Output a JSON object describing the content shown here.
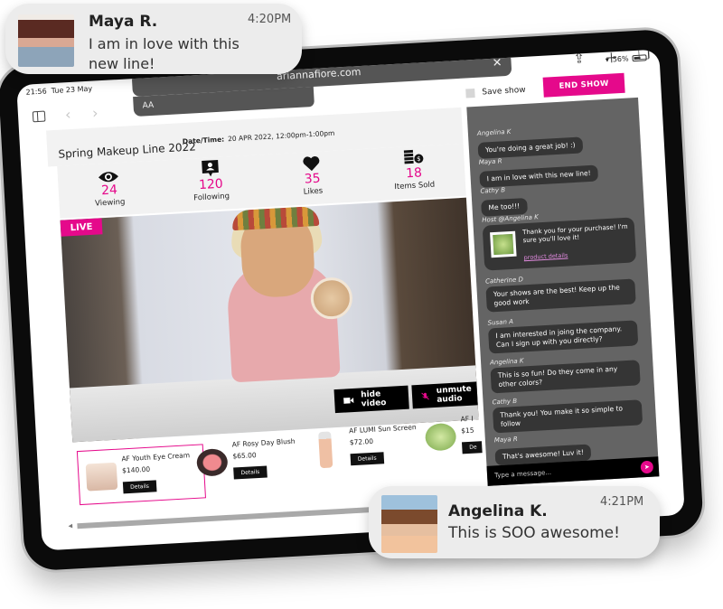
{
  "notifications": [
    {
      "name": "Maya R.",
      "message": "I am in love with this new line!",
      "time": "4:20PM"
    },
    {
      "name": "Angelina K.",
      "message": "This is SOO awesome!",
      "time": "4:21PM"
    }
  ],
  "statusbar": {
    "time": "21:56",
    "date": "Tue 23 May",
    "battery": "56%"
  },
  "browser": {
    "url": "ariannafiore.com",
    "text_size_label": "AA",
    "icons": [
      "sidebar-icon",
      "back-icon",
      "forward-icon",
      "share-icon",
      "new-tab-icon",
      "tabs-icon",
      "clear-icon"
    ]
  },
  "controls": {
    "save_show_label": "Save show",
    "end_show_label": "END SHOW"
  },
  "show": {
    "title": "Spring Makeup Line 2022",
    "datetime_label": "Date/Time:",
    "datetime_value": "20 APR 2022, 12:00pm-1:00pm"
  },
  "stats": [
    {
      "icon": "eye-icon",
      "value": "24",
      "label": "Viewing"
    },
    {
      "icon": "follower-icon",
      "value": "120",
      "label": "Following"
    },
    {
      "icon": "heart-icon",
      "value": "35",
      "label": "Likes"
    },
    {
      "icon": "coins-icon",
      "value": "18",
      "label": "Items Sold"
    }
  ],
  "video": {
    "live_label": "LIVE",
    "hide_video_label": "hide video",
    "unmute_audio_label": "unmute audio"
  },
  "products": [
    {
      "name": "AF Youth Eye Cream",
      "price": "$140.00",
      "details_label": "Details",
      "selected": true
    },
    {
      "name": "AF Rosy Day Blush",
      "price": "$65.00",
      "details_label": "Details"
    },
    {
      "name": "AF LUMI Sun Screen",
      "price": "$72.00",
      "details_label": "Details"
    },
    {
      "name": "AF I",
      "price": "$15",
      "details_label": "De"
    }
  ],
  "chat": {
    "messages": [
      {
        "user": "Angelina K",
        "text": "You're doing a great job! :)"
      },
      {
        "user": "Maya R",
        "text": "I am in love with this new line!"
      },
      {
        "user": "Cathy B",
        "text": "Me too!!!"
      },
      {
        "user": "Host @Angelina K",
        "text": "Thank you for your purchase! I'm sure you'll love it!",
        "link": "product details"
      },
      {
        "user": "Catherine D",
        "text": "Your shows are the best!  Keep up the good work"
      },
      {
        "user": "Susan A",
        "text": "I am interested in joing the company. Can I sign up with you directly?"
      },
      {
        "user": "Angelina K",
        "text": "This is so fun!  Do they come in any other colors?"
      },
      {
        "user": "Cathy B",
        "text": "Thank you! You make it so simple to follow"
      },
      {
        "user": "Maya R",
        "text": "That's awesome! Luv it!"
      }
    ],
    "input_placeholder": "Type a message..."
  },
  "colors": {
    "accent": "#e5098b",
    "chat_bg": "#646464",
    "bubble": "#353535"
  }
}
